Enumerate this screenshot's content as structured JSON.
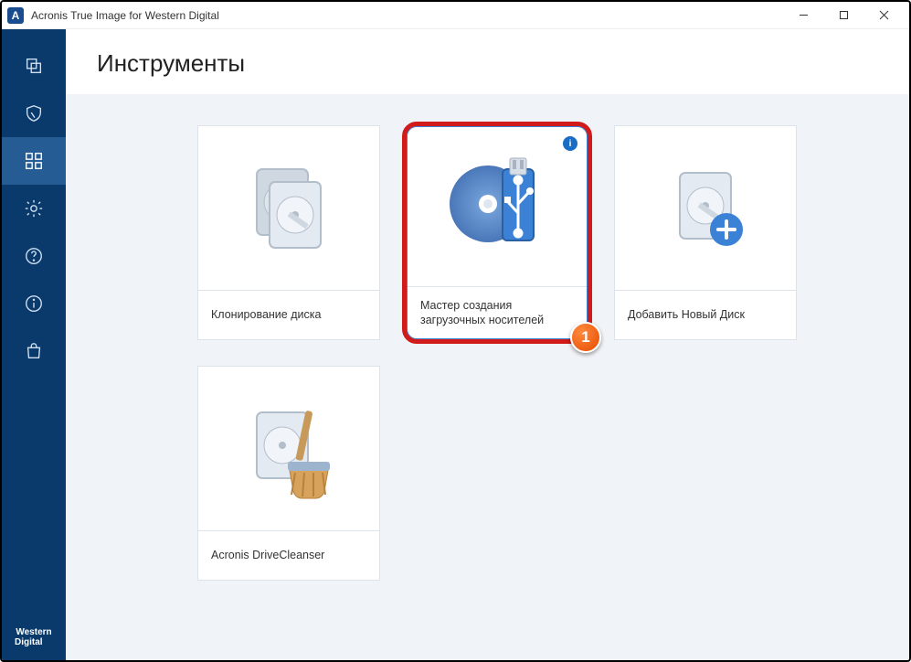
{
  "titlebar": {
    "app_letter": "A",
    "title": "Acronis True Image for Western Digital"
  },
  "sidebar": {
    "items": [
      {
        "name": "backup",
        "icon": "copy-icon"
      },
      {
        "name": "protection",
        "icon": "shield-icon"
      },
      {
        "name": "tools",
        "icon": "grid-icon",
        "active": true
      },
      {
        "name": "settings",
        "icon": "gear-icon"
      },
      {
        "name": "help",
        "icon": "help-icon"
      },
      {
        "name": "about",
        "icon": "info-icon"
      },
      {
        "name": "store",
        "icon": "bag-icon"
      }
    ],
    "brand_line1": "Western",
    "brand_line2": "Digital"
  },
  "page": {
    "title": "Инструменты"
  },
  "cards": [
    {
      "id": "clone-disk",
      "label": "Клонирование диска",
      "icon": "clone-disk-icon"
    },
    {
      "id": "rescue-media",
      "label": "Мастер создания загрузочных носителей",
      "icon": "rescue-media-icon",
      "highlighted": true,
      "info": "i",
      "callout": "1"
    },
    {
      "id": "add-disk",
      "label": "Добавить Новый Диск",
      "icon": "add-disk-icon"
    },
    {
      "id": "drive-cleanser",
      "label": "Acronis DriveCleanser",
      "icon": "drive-cleanser-icon"
    }
  ]
}
